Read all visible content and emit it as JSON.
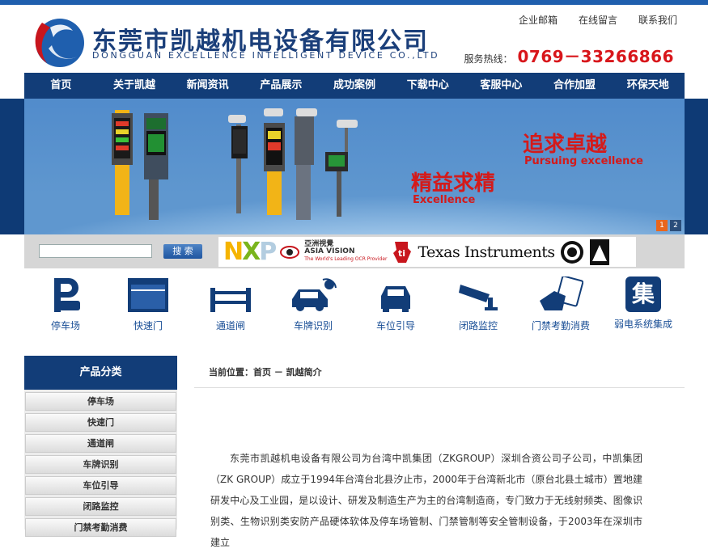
{
  "header": {
    "logo_cn": "东莞市凯越机电设备有限公司",
    "logo_en": "DONGGUAN EXCELLENCE INTELLIGENT DEVICE CO.,LTD",
    "toplinks": [
      "企业邮箱",
      "在线留言",
      "联系我们"
    ],
    "hotline_label": "服务热线：",
    "hotline_number": "0769－33266866",
    "accent_color": "#123d78",
    "hotline_color": "#d8161b"
  },
  "nav": {
    "items": [
      "首页",
      "关于凯越",
      "新闻资讯",
      "产品展示",
      "成功案例",
      "下载中心",
      "客服中心",
      "合作加盟",
      "环保天地"
    ]
  },
  "banner": {
    "slogan1": "追求卓越",
    "slogan1_en": "Pursuing excellence",
    "slogan2": "精益求精",
    "slogan2_en": "Excellence",
    "slides": [
      "1",
      "2"
    ],
    "active_slide": 1
  },
  "search": {
    "placeholder": "",
    "button_label": "搜 索"
  },
  "brands": {
    "nxp": "NXP",
    "asia_vision_cn": "亞洲視覺",
    "asia_vision_en": "ASIA VISION",
    "asia_vision_tag": "The World's Leading OCR Provider",
    "ti": "Texas Instruments"
  },
  "categories_icons": [
    {
      "label": "停车场",
      "icon": "parking-icon"
    },
    {
      "label": "快速门",
      "icon": "fast-door-icon"
    },
    {
      "label": "通道闸",
      "icon": "gate-icon"
    },
    {
      "label": "车牌识别",
      "icon": "plate-recognition-icon"
    },
    {
      "label": "车位引导",
      "icon": "parking-guide-icon"
    },
    {
      "label": "闭路监控",
      "icon": "cctv-icon"
    },
    {
      "label": "门禁考勤消费",
      "icon": "access-card-icon"
    },
    {
      "label": "弱电系统集成",
      "icon": "integration-icon",
      "glyph": "集"
    }
  ],
  "sidebar": {
    "title": "产品分类",
    "items": [
      "停车场",
      "快速门",
      "通道闸",
      "车牌识别",
      "车位引导",
      "闭路监控",
      "门禁考勤消费"
    ]
  },
  "breadcrumb": "当前位置：首页 － 凯越简介",
  "content": {
    "paragraph": "东莞市凯越机电设备有限公司为台湾中凯集团（ZKGROUP）深圳合资公司子公司，中凯集团（ZK GROUP）成立于1994年台湾台北县汐止市，2000年于台湾新北市（原台北县土城市）置地建研发中心及工业园，是以设计、研发及制造生产为主的台湾制造商，专门致力于无线射频类、图像识别类、生物识别类安防产品硬体软体及停车场管制、门禁管制等安全管制设备，于2003年在深圳市建立"
  }
}
